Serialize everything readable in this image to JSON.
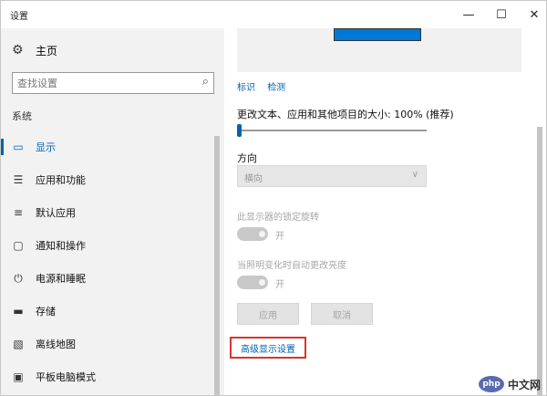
{
  "window": {
    "title": "设置",
    "min_icon": "minimize-icon",
    "max_icon": "maximize-icon",
    "close_icon": "close-icon"
  },
  "sidebar": {
    "home_label": "主页",
    "home_icon": "gear-icon",
    "search_placeholder": "查找设置",
    "search_icon": "search-icon",
    "section_label": "系统",
    "items": [
      {
        "label": "显示",
        "icon": "monitor-icon",
        "active": true
      },
      {
        "label": "应用和功能",
        "icon": "list-icon",
        "active": false
      },
      {
        "label": "默认应用",
        "icon": "default-apps-icon",
        "active": false
      },
      {
        "label": "通知和操作",
        "icon": "notification-icon",
        "active": false
      },
      {
        "label": "电源和睡眠",
        "icon": "power-icon",
        "active": false
      },
      {
        "label": "存储",
        "icon": "storage-icon",
        "active": false
      },
      {
        "label": "离线地图",
        "icon": "map-icon",
        "active": false
      },
      {
        "label": "平板电脑模式",
        "icon": "tablet-icon",
        "active": false
      }
    ]
  },
  "main": {
    "identify_link": "标识",
    "detect_link": "检测",
    "scale_label": "更改文本、应用和其他项目的大小: 100% (推荐)",
    "scale_value_percent": 100,
    "orientation_label": "方向",
    "orientation_value": "横向",
    "rotation_lock_label": "此显示器的锁定旋转",
    "rotation_lock_state": "开",
    "auto_brightness_label": "当照明变化时自动更改亮度",
    "auto_brightness_state": "开",
    "apply_button": "应用",
    "cancel_button": "取消",
    "advanced_link": "高级显示设置"
  },
  "watermark": {
    "logo": "php",
    "text": "中文网"
  },
  "colors": {
    "accent": "#0063b1",
    "highlight_border": "#d9342b"
  }
}
